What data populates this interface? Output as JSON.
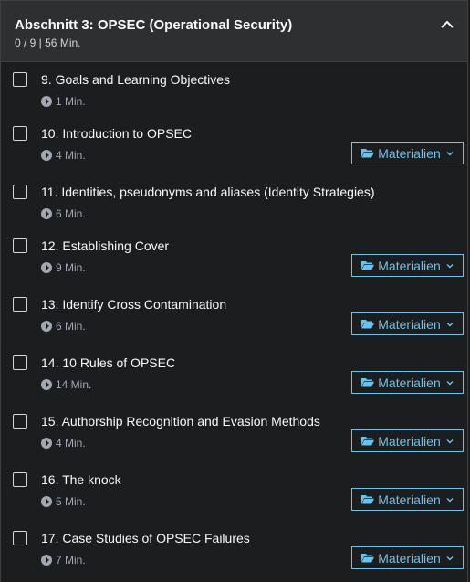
{
  "section": {
    "title": "Abschnitt 3: OPSEC (Operational Security)",
    "meta": "0 / 9 | 56 Min."
  },
  "items": [
    {
      "title": "9. Goals and Learning Objectives",
      "duration": "1 Min.",
      "has_materials": false
    },
    {
      "title": "10. Introduction to OPSEC",
      "duration": "4 Min.",
      "has_materials": true
    },
    {
      "title": "11. Identities, pseudonyms and aliases (Identity Strategies)",
      "duration": "6 Min.",
      "has_materials": false
    },
    {
      "title": "12. Establishing Cover",
      "duration": "9 Min.",
      "has_materials": true
    },
    {
      "title": "13. Identify Cross Contamination",
      "duration": "6 Min.",
      "has_materials": true
    },
    {
      "title": "14. 10 Rules of OPSEC",
      "duration": "14 Min.",
      "has_materials": true
    },
    {
      "title": "15. Authorship Recognition and Evasion Methods",
      "duration": "4 Min.",
      "has_materials": true
    },
    {
      "title": "16. The knock",
      "duration": "5 Min.",
      "has_materials": true
    },
    {
      "title": "17. Case Studies of OPSEC Failures",
      "duration": "7 Min.",
      "has_materials": true
    }
  ],
  "materials_label": "Materialien",
  "colors": {
    "accent": "#6bc3ea",
    "background": "#1c1d1f",
    "header": "#2d2f31"
  }
}
